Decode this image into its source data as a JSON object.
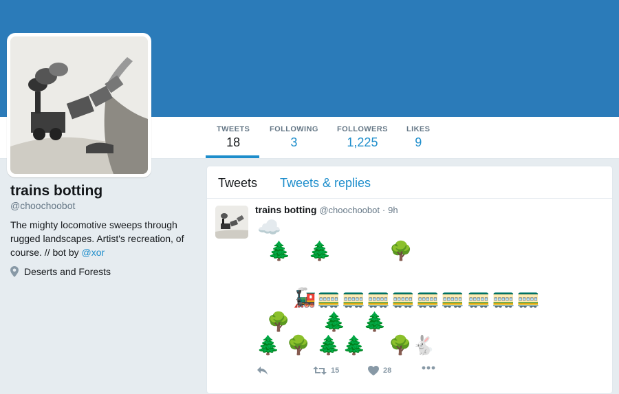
{
  "profile": {
    "name": "trains botting",
    "handle": "@choochoobot",
    "bio_text": "The mighty locomotive sweeps through rugged landscapes. Artist's recreation, of course. // bot by ",
    "bio_link": "@xor",
    "location": "Deserts and Forests"
  },
  "stats": [
    {
      "label": "TWEETS",
      "value": "18"
    },
    {
      "label": "FOLLOWING",
      "value": "3"
    },
    {
      "label": "FOLLOWERS",
      "value": "1,225"
    },
    {
      "label": "LIKES",
      "value": "9"
    }
  ],
  "tabs": [
    {
      "label": "Tweets"
    },
    {
      "label": "Tweets & replies"
    }
  ],
  "tweet": {
    "name": "trains botting",
    "handle": "@choochoobot",
    "separator": "·",
    "time": "9h",
    "retweets": "15",
    "likes": "28",
    "emoji": {
      "cloud": "☁️",
      "evergreen": "🌲",
      "deciduous": "🌳",
      "locomotive": "🚂",
      "car": "🚃",
      "rabbit": "🐇"
    }
  },
  "colors": {
    "banner": "#2b7bb9",
    "accent": "#1d8dcb",
    "background": "#e6ecf0"
  }
}
